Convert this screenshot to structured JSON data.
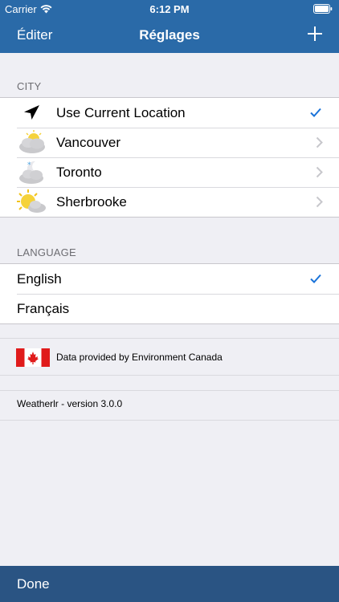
{
  "status_bar": {
    "carrier": "Carrier",
    "time": "6:12 PM"
  },
  "nav": {
    "edit_label": "Éditer",
    "title": "Réglages",
    "add_icon": "plus-icon"
  },
  "city_section": {
    "header": "CITY",
    "items": [
      {
        "label": "Use Current Location",
        "icon": "location-arrow-icon",
        "accessory": "checkmark"
      },
      {
        "label": "Vancouver",
        "icon": "cloudy-sun-icon",
        "accessory": "chevron"
      },
      {
        "label": "Toronto",
        "icon": "night-cloud-icon",
        "accessory": "chevron"
      },
      {
        "label": "Sherbrooke",
        "icon": "sun-cloud-icon",
        "accessory": "chevron"
      }
    ]
  },
  "language_section": {
    "header": "LANGUAGE",
    "items": [
      {
        "label": "English",
        "accessory": "checkmark"
      },
      {
        "label": "Français",
        "accessory": "none"
      }
    ]
  },
  "info": {
    "provider_text": "Data provided by Environment Canada",
    "flag_icon": "canada-flag-icon",
    "version_text": "Weatherlr - version 3.0.0"
  },
  "bottom": {
    "done_label": "Done"
  },
  "colors": {
    "nav_blue": "#2a6aa8",
    "bottom_blue": "#2a5483",
    "accent_check": "#1a73d9",
    "group_bg": "#efeff4"
  }
}
